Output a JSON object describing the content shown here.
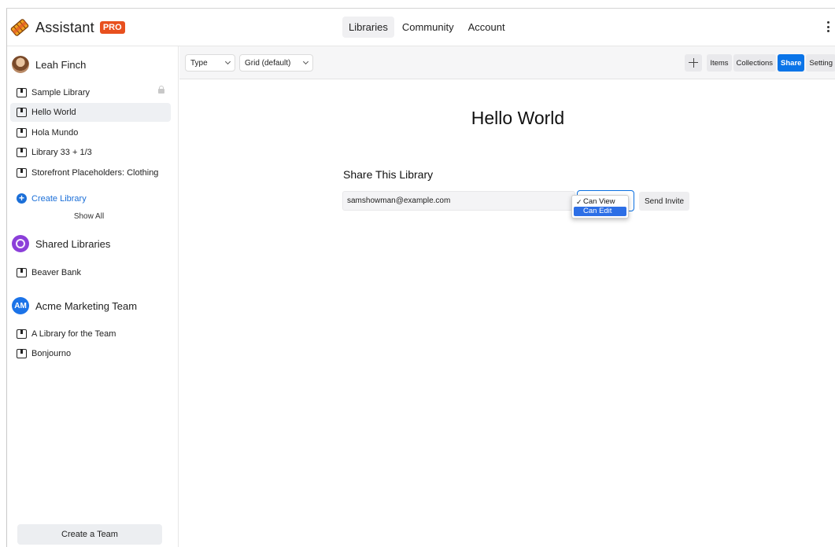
{
  "app": {
    "name": "Assistant",
    "badge": "PRO"
  },
  "nav": {
    "items": [
      "Libraries",
      "Community",
      "Account"
    ],
    "active": "Libraries"
  },
  "sidebar": {
    "owner": {
      "name": "Leah Finch"
    },
    "libraries": [
      {
        "label": "Sample Library",
        "locked": true
      },
      {
        "label": "Hello World",
        "active": true
      },
      {
        "label": "Hola Mundo"
      },
      {
        "label": "Library 33 + 1/3"
      },
      {
        "label": "Storefront Placeholders: Clothing"
      }
    ],
    "create_library": "Create Library",
    "show_all": "Show All",
    "shared": {
      "title": "Shared Libraries",
      "libraries": [
        {
          "label": "Beaver Bank"
        }
      ]
    },
    "team": {
      "initials": "AM",
      "name": "Acme Marketing Team",
      "libraries": [
        {
          "label": "A Library for the Team"
        },
        {
          "label": "Bonjourno"
        }
      ]
    },
    "create_team": "Create a Team"
  },
  "toolbar": {
    "type_label": "Type",
    "view_label": "Grid (default)",
    "buttons": [
      "Items",
      "Collections",
      "Share",
      "Setting"
    ],
    "active_button": "Share"
  },
  "main": {
    "title": "Hello World",
    "share_heading": "Share This Library",
    "email_value": "samshowman@example.com",
    "permission_options": [
      "Can View",
      "Can Edit"
    ],
    "permission_selected": "Can View",
    "permission_highlighted": "Can Edit",
    "send_invite": "Send Invite"
  },
  "colors": {
    "accent": "#0a74e8",
    "pro_badge": "#e8501e",
    "team_avatar": "#1b73e8",
    "shared_avatar": "#8b3fd9"
  }
}
